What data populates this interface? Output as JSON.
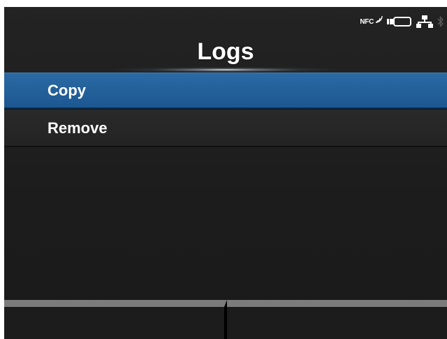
{
  "status_bar": {
    "nfc_label": "NFC",
    "icons": [
      "nfc-icon",
      "battery-icon",
      "network-icon",
      "bluetooth-icon"
    ]
  },
  "header": {
    "title": "Logs"
  },
  "menu": {
    "items": [
      {
        "label": "Copy",
        "selected": true
      },
      {
        "label": "Remove",
        "selected": false
      }
    ]
  },
  "softkeys": {
    "left_label": "",
    "right_label": ""
  },
  "colors": {
    "selection": "#1d5791",
    "background": "#1c1c1c",
    "softkey_bar": "#7c7c7c"
  }
}
